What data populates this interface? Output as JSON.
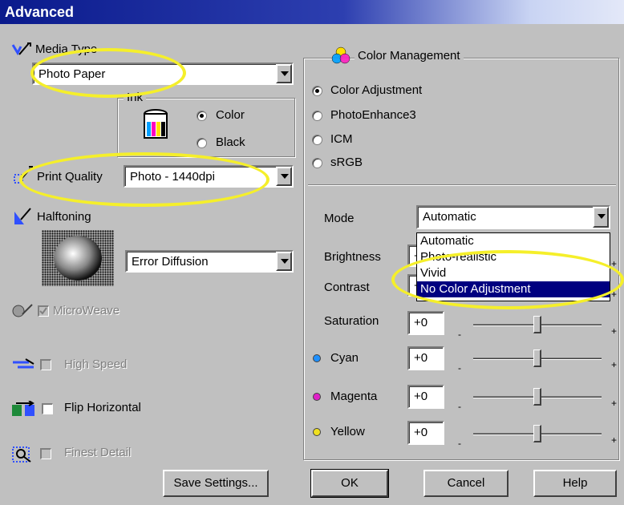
{
  "window": {
    "title": "Advanced"
  },
  "media_type": {
    "label": "Media Type",
    "value": "Photo Paper"
  },
  "ink": {
    "label": "Ink",
    "options": [
      "Color",
      "Black"
    ],
    "selected": "Color"
  },
  "print_quality": {
    "label": "Print Quality",
    "value": "Photo - 1440dpi"
  },
  "halftoning": {
    "label": "Halftoning",
    "value": "Error Diffusion"
  },
  "options": {
    "microweave": {
      "label": "MicroWeave",
      "checked": true,
      "enabled": false
    },
    "high_speed": {
      "label": "High Speed",
      "checked": false,
      "enabled": false
    },
    "flip_horizontal": {
      "label": "Flip Horizontal",
      "checked": false,
      "enabled": true
    },
    "finest_detail": {
      "label": "Finest Detail",
      "checked": false,
      "enabled": false
    }
  },
  "color_management": {
    "title": "Color Management",
    "modes": [
      "Color Adjustment",
      "PhotoEnhance3",
      "ICM",
      "sRGB"
    ],
    "selected": "Color Adjustment"
  },
  "mode": {
    "label": "Mode",
    "value": "Automatic",
    "dropdown_options": [
      "Automatic",
      "Photo-realistic",
      "Vivid",
      "No Color Adjustment"
    ],
    "highlighted": "No Color Adjustment"
  },
  "sliders": [
    {
      "label": "Brightness",
      "value": "+0",
      "level": 0
    },
    {
      "label": "Contrast",
      "value": "+0",
      "level": 0
    },
    {
      "label": "Saturation",
      "value": "+0",
      "level": 0
    },
    {
      "label": "Cyan",
      "value": "+0",
      "level": 0,
      "color": "#1e90ff"
    },
    {
      "label": "Magenta",
      "value": "+0",
      "level": 0,
      "color": "#e020c8"
    },
    {
      "label": "Yellow",
      "value": "+0",
      "level": 0,
      "color": "#f0e020"
    }
  ],
  "slider_ticks": {
    "min": "-",
    "max": "+"
  },
  "buttons": {
    "save": "Save Settings...",
    "ok": "OK",
    "cancel": "Cancel",
    "help": "Help"
  },
  "icons": {
    "media_type": "media-type-icon",
    "print_quality": "print-quality-icon",
    "halftoning": "halftoning-icon",
    "ink": "ink-bottle-icon",
    "color_management": "color-circles-icon",
    "microweave": "microweave-icon",
    "high_speed": "high-speed-icon",
    "flip": "flip-horizontal-icon",
    "finest": "finest-detail-icon"
  },
  "highlight_color": "#f5ef2a"
}
